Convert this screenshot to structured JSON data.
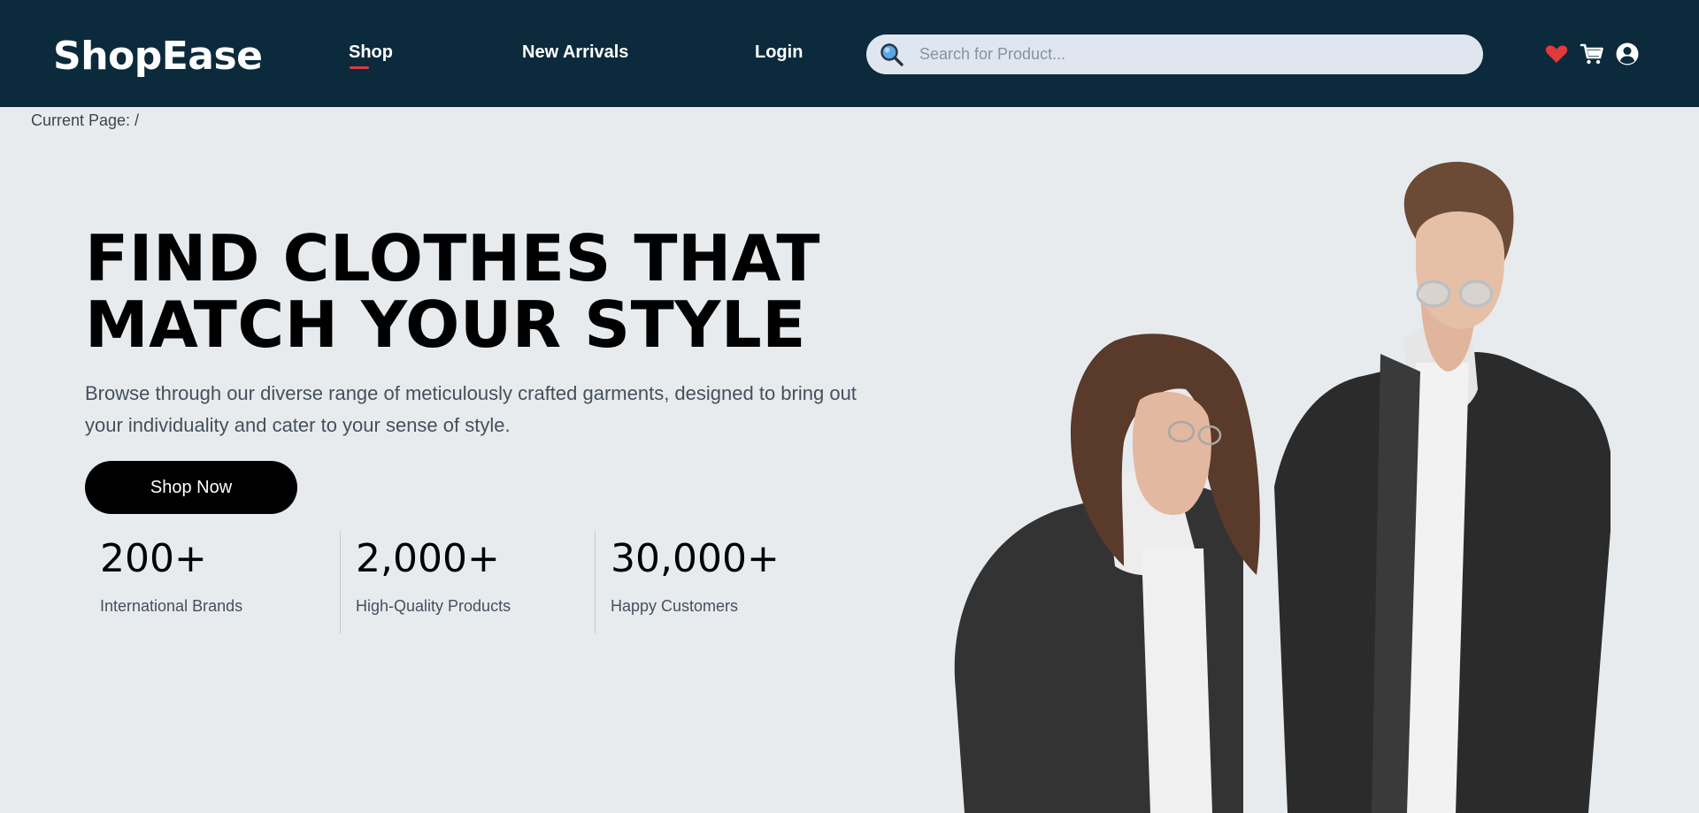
{
  "header": {
    "logo": "ShopEase",
    "nav": [
      {
        "label": "Shop",
        "active": true
      },
      {
        "label": "New Arrivals",
        "active": false
      },
      {
        "label": "Login",
        "active": false
      }
    ],
    "search": {
      "placeholder": "Search for Product...",
      "value": ""
    },
    "icons": [
      "heart-icon",
      "cart-icon",
      "user-icon"
    ],
    "colors": {
      "background": "#0b2a3c",
      "accent": "#e0393e"
    }
  },
  "breadcrumb": "Current Page: /",
  "hero": {
    "title_line1": "FIND CLOTHES THAT",
    "title_line2": "MATCH YOUR STYLE",
    "subtitle": "Browse through our diverse range of meticulously crafted garments, designed to bring out your individuality and cater to your sense of style.",
    "cta_label": "Shop Now",
    "stats": [
      {
        "value": "200+",
        "label": "International Brands"
      },
      {
        "value": "2,000+",
        "label": "High-Quality Products"
      },
      {
        "value": "30,000+",
        "label": "Happy Customers"
      }
    ]
  }
}
